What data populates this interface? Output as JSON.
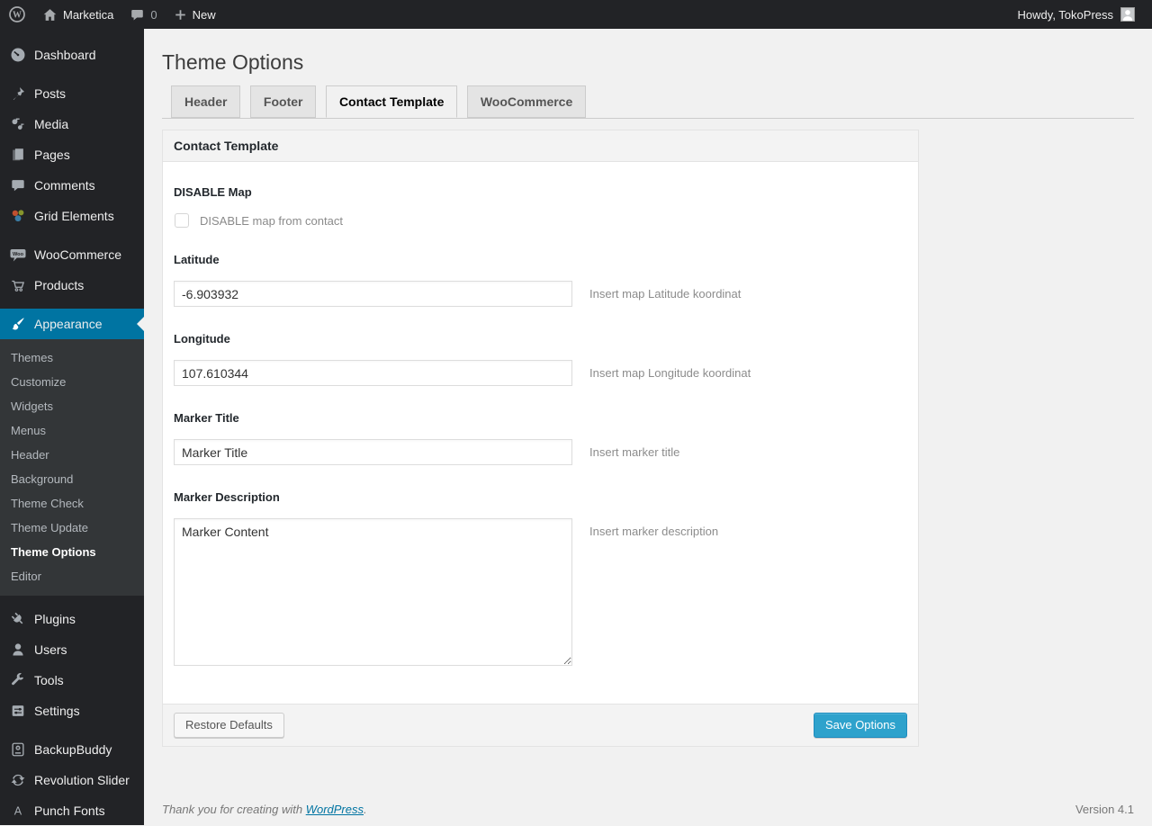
{
  "admin_bar": {
    "site_name": "Marketica",
    "comment_count": "0",
    "new_label": "New",
    "howdy": "Howdy, TokoPress"
  },
  "sidebar": {
    "items": [
      {
        "label": "Dashboard",
        "icon": "dashboard-icon"
      },
      {
        "label": "Posts",
        "icon": "pushpin-icon"
      },
      {
        "label": "Media",
        "icon": "media-icon"
      },
      {
        "label": "Pages",
        "icon": "pages-icon"
      },
      {
        "label": "Comments",
        "icon": "comment-icon"
      },
      {
        "label": "Grid Elements",
        "icon": "grid-elements-icon"
      },
      {
        "label": "WooCommerce",
        "icon": "woocommerce-icon"
      },
      {
        "label": "Products",
        "icon": "cart-icon"
      },
      {
        "label": "Appearance",
        "icon": "brush-icon",
        "active": true
      },
      {
        "label": "Plugins",
        "icon": "plugin-icon"
      },
      {
        "label": "Users",
        "icon": "user-icon"
      },
      {
        "label": "Tools",
        "icon": "wrench-icon"
      },
      {
        "label": "Settings",
        "icon": "settings-icon"
      },
      {
        "label": "BackupBuddy",
        "icon": "backup-icon"
      },
      {
        "label": "Revolution Slider",
        "icon": "refresh-icon"
      },
      {
        "label": "Punch Fonts",
        "icon": "font-icon"
      }
    ],
    "appearance_submenu": [
      "Themes",
      "Customize",
      "Widgets",
      "Menus",
      "Header",
      "Background",
      "Theme Check",
      "Theme Update",
      "Theme Options",
      "Editor"
    ],
    "current_submenu_item": "Theme Options"
  },
  "page": {
    "title": "Theme Options",
    "tabs": [
      "Header",
      "Footer",
      "Contact Template",
      "WooCommerce"
    ],
    "active_tab": "Contact Template"
  },
  "panel": {
    "title": "Contact Template",
    "disable_map": {
      "label": "DISABLE Map",
      "checkbox_label": "DISABLE map from contact",
      "checked": false
    },
    "latitude": {
      "label": "Latitude",
      "value": "-6.903932",
      "help": "Insert map Latitude koordinat"
    },
    "longitude": {
      "label": "Longitude",
      "value": "107.610344",
      "help": "Insert map Longitude koordinat"
    },
    "marker_title": {
      "label": "Marker Title",
      "value": "Marker Title",
      "help": "Insert marker title"
    },
    "marker_description": {
      "label": "Marker Description",
      "value": "Marker Content",
      "help": "Insert marker description"
    },
    "restore_button": "Restore Defaults",
    "save_button": "Save Options"
  },
  "footer": {
    "thanks_text": "Thank you for creating with ",
    "wordpress_link": "WordPress",
    "period": ".",
    "version": "Version 4.1"
  },
  "colors": {
    "accent": "#0074a2",
    "primary_button": "#2ea2cc",
    "primary_button_border": "#1e8cbe",
    "dark_bg": "#222326",
    "submenu_bg": "#333638",
    "page_bg": "#f1f1f1"
  }
}
